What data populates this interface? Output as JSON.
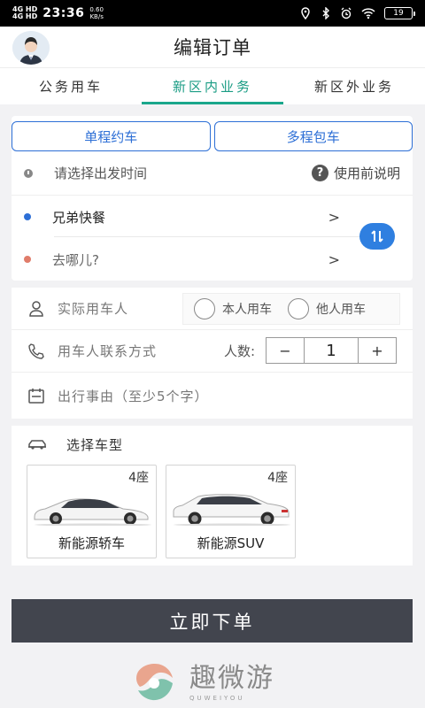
{
  "status_bar": {
    "network_top": "4G HD",
    "network_bottom": "4G HD",
    "time": "23:36",
    "speed_value": "0.60",
    "speed_unit": "KB/s",
    "battery": "19"
  },
  "header": {
    "title": "编辑订单"
  },
  "tabs": [
    {
      "label": "公务用车",
      "active": false
    },
    {
      "label": "新区内业务",
      "active": true
    },
    {
      "label": "新区外业务",
      "active": false
    }
  ],
  "trip_type": {
    "single": "单程约车",
    "multi": "多程包车"
  },
  "departure": {
    "placeholder": "请选择出发时间",
    "help_label": "使用前说明"
  },
  "route": {
    "origin": "兄弟快餐",
    "destination_placeholder": "去哪儿?",
    "arrow": ">"
  },
  "passenger": {
    "name_placeholder": "实际用车人",
    "option_self": "本人用车",
    "option_other": "他人用车",
    "contact_placeholder": "用车人联系方式",
    "count_label": "人数:",
    "count_value": "1",
    "minus": "−",
    "plus": "+",
    "reason_placeholder": "出行事由（至少5个字）"
  },
  "vehicle": {
    "title": "选择车型",
    "options": [
      {
        "seats": "4座",
        "name": "新能源轿车"
      },
      {
        "seats": "4座",
        "name": "新能源SUV"
      }
    ]
  },
  "submit_label": "立即下单",
  "brand": {
    "name": "趣微游",
    "sub": "QUWEIYOU"
  },
  "colors": {
    "accent_tab": "#1a9c84",
    "accent_blue": "#2d6fd6",
    "submit_bg": "#42454e"
  }
}
